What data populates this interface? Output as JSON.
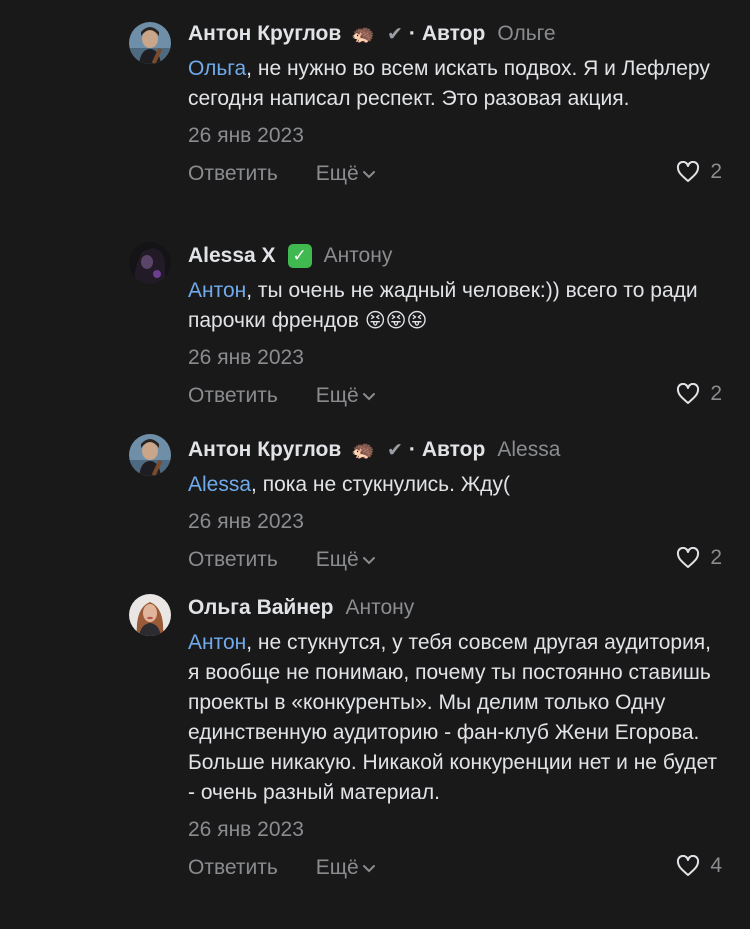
{
  "colors": {
    "background": "#19191a",
    "text": "#e1e3e6",
    "secondary": "#8a8c90",
    "mention": "#71aaeb",
    "verified": "#3fb950"
  },
  "actions": {
    "reply_label": "Ответить",
    "more_label": "Ещё"
  },
  "comments": [
    {
      "author": "Антон Круглов",
      "author_emoji": "🦔",
      "verified_check": "✔",
      "dot": "·",
      "role": "Автор",
      "reply_to": "Ольге",
      "mention": "Ольга",
      "text_rest": ", не нужно во всем искать подвох. Я и Лефлеру сегодня написал респект. Это разовая акция.",
      "date": "26 янв 2023",
      "likes": "2",
      "avatar_icon": "man-with-guitar-avatar"
    },
    {
      "author": "Alessa X",
      "verified_badge": "✓",
      "reply_to": "Антону",
      "mention": "Антон",
      "text_rest": ", ты очень не жадный человек:)) всего то ради парочки френдов ",
      "text_emoji": "😝😝😝",
      "date": "26 янв 2023",
      "likes": "2",
      "avatar_icon": "dark-portrait-avatar"
    },
    {
      "author": "Антон Круглов",
      "author_emoji": "🦔",
      "verified_check": "✔",
      "dot": "·",
      "role": "Автор",
      "reply_to": "Alessa",
      "mention": "Alessa",
      "text_rest": ", пока не стукнулись. Жду(",
      "date": "26 янв 2023",
      "likes": "2",
      "avatar_icon": "man-with-guitar-avatar"
    },
    {
      "author": "Ольга Вайнер",
      "reply_to": "Антону",
      "mention": "Антон",
      "text_rest": ", не стукнутся, у тебя совсем другая аудитория, я вообще не понимаю, почему ты постоянно ставишь проекты в «конкуренты». Мы делим только Одну единственную аудиторию - фан-клуб Жени Егорова. Больше никакую. Никакой конкуренции нет и не будет - очень разный материал.",
      "date": "26 янв 2023",
      "likes": "4",
      "avatar_icon": "woman-portrait-avatar"
    }
  ]
}
